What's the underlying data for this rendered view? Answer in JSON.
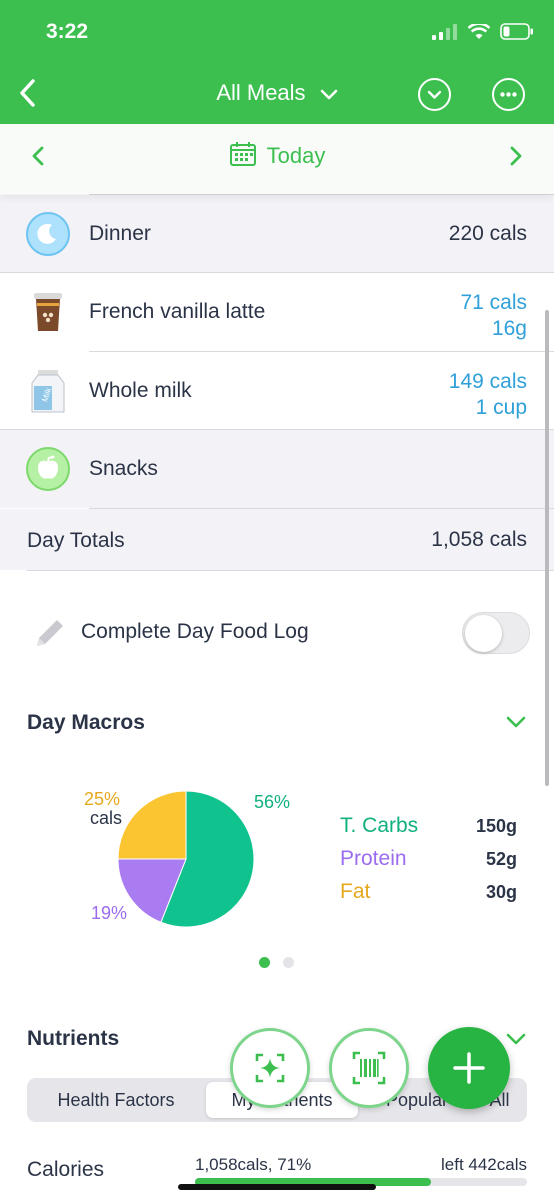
{
  "status": {
    "time": "3:22"
  },
  "nav": {
    "title": "All Meals"
  },
  "datebar": {
    "label": "Today"
  },
  "meals": {
    "dinner": {
      "label": "Dinner",
      "calories": "220 cals"
    },
    "snacks": {
      "label": "Snacks"
    }
  },
  "foods": [
    {
      "name": "French vanilla latte",
      "cals": "71 cals",
      "qty": "16g"
    },
    {
      "name": "Whole milk",
      "cals": "149 cals",
      "qty": "1 cup"
    }
  ],
  "day_totals": {
    "label": "Day Totals",
    "value": "1,058 cals"
  },
  "food_log": {
    "label": "Complete Day Food Log",
    "toggle_on": false
  },
  "macros": {
    "title": "Day Macros",
    "chart_data": {
      "type": "pie",
      "slices": [
        {
          "label": "T. Carbs",
          "percent": 56,
          "amount": "150g",
          "color": "#10c28e"
        },
        {
          "label": "Protein",
          "percent": 19,
          "amount": "52g",
          "color": "#a97cf2"
        },
        {
          "label": "Fat",
          "percent": 25,
          "amount": "30g",
          "color": "#fbc531"
        }
      ],
      "labels": {
        "carbs_pct": "56%",
        "protein_pct": "19%",
        "fat_pct": "25%",
        "fat_sub": "cals"
      }
    },
    "page_dots": {
      "count": 2,
      "active": 0
    }
  },
  "nutrients": {
    "title": "Nutrients",
    "tabs": [
      "Health Factors",
      "My Nutrients",
      "Popular",
      "All"
    ],
    "active_tab": 1,
    "calories_row": {
      "label": "Calories",
      "consumed": "1,058cals, 71%",
      "left": "left 442cals",
      "progress": 0.71
    }
  },
  "colors": {
    "brand_green": "#3cbf4f",
    "link_blue": "#2fa0d8",
    "carbs": "#10c28e",
    "protein": "#a97cf2",
    "fat": "#fbc531"
  },
  "icons": [
    "chevron-left-icon",
    "chevron-down-icon",
    "circle-chevron-down-icon",
    "more-icon",
    "calendar-icon",
    "chevron-right-icon",
    "moon-icon",
    "coffee-cup-icon",
    "milk-carton-icon",
    "apple-icon",
    "pencil-icon",
    "sparkle-scan-icon",
    "barcode-icon",
    "plus-icon"
  ]
}
